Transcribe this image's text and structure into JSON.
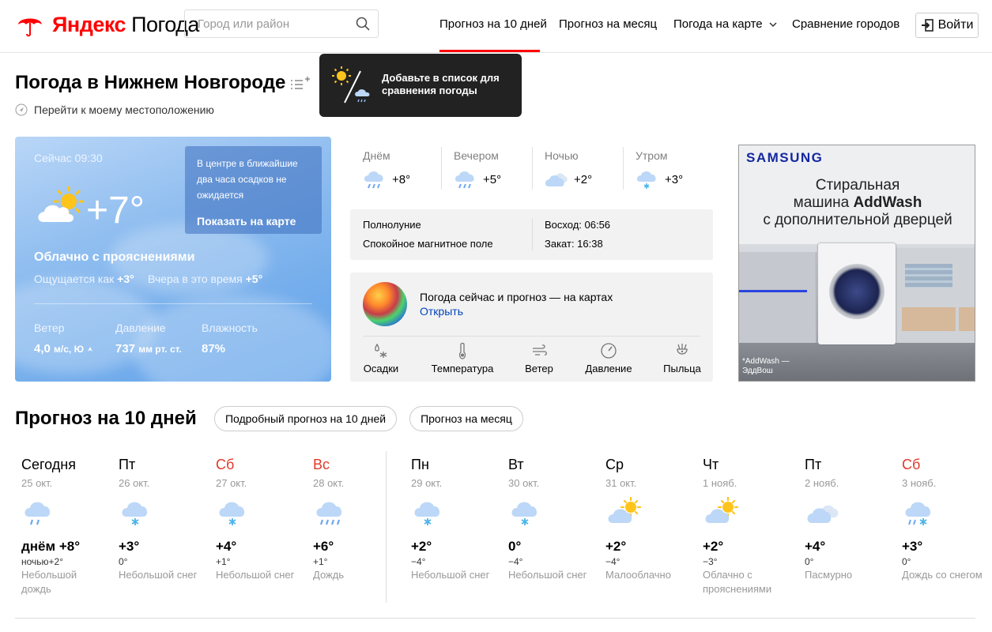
{
  "header": {
    "logo_brand": "Яндекс",
    "logo_product": "Погода",
    "search_placeholder": "Город или район",
    "nav": [
      "Прогноз на 10 дней",
      "Прогноз на месяц",
      "Погода на карте",
      "Сравнение городов"
    ],
    "login": "Войти",
    "accent_color": "#ff0000"
  },
  "title": {
    "text": "Погода в Нижнем Новгороде",
    "location_link": "Перейти к моему местоположению",
    "tooltip": "Добавьте в список для сравнения погоды"
  },
  "now": {
    "time": "Сейчас 09:30",
    "temp": "+7°",
    "icon": "partly-cloudy-icon",
    "popup_text": "В центре в ближайшие два часа осадков не ожидается",
    "popup_link": "Показать на карте",
    "condition": "Облачно с прояснениями",
    "feels_label": "Ощущается как",
    "feels_value": "+3°",
    "yesterday_label": "Вчера в это время",
    "yesterday_value": "+5°",
    "wind_label": "Ветер",
    "wind_value": "4,0",
    "wind_unit": "м/с, Ю",
    "pressure_label": "Давление",
    "pressure_value": "737",
    "pressure_unit": "мм рт. ст.",
    "humidity_label": "Влажность",
    "humidity_value": "87%"
  },
  "parts": [
    {
      "name": "Днём",
      "temp": "+8°",
      "icon": "rain-cloud-icon"
    },
    {
      "name": "Вечером",
      "temp": "+5°",
      "icon": "rain-cloud-icon"
    },
    {
      "name": "Ночью",
      "temp": "+2°",
      "icon": "cloudy-icon"
    },
    {
      "name": "Утром",
      "temp": "+3°",
      "icon": "snow-cloud-icon"
    }
  ],
  "astro": {
    "moon": "Полнолуние",
    "magnetic": "Спокойное магнитное поле",
    "sunrise": "Восход: 06:56",
    "sunset": "Закат: 16:38"
  },
  "maps": {
    "title": "Погода сейчас и прогноз — на картах",
    "open": "Открыть",
    "items": [
      "Осадки",
      "Температура",
      "Ветер",
      "Давление",
      "Пыльца"
    ]
  },
  "ad": {
    "brand": "SAMSUNG",
    "line1": "Стиральная",
    "line2_pre": "машина ",
    "line2_bold": "AddWash",
    "line3": "с дополнительной дверцей",
    "caption1": "*AddWash —",
    "caption2": "ЭддВош"
  },
  "forecast": {
    "title": "Прогноз на 10 дней",
    "btn_detailed": "Подробный прогноз на 10 дней",
    "btn_month": "Прогноз на месяц",
    "days": [
      {
        "name": "Сегодня",
        "date": "25 окт.",
        "hi": "днём +8°",
        "lo": "ночью+2°",
        "cond": "Небольшой дождь",
        "weekend": false,
        "icon": "rain-cloud-icon"
      },
      {
        "name": "Пт",
        "date": "26 окт.",
        "hi": "+3°",
        "lo": "0°",
        "cond": "Небольшой снег",
        "weekend": false,
        "icon": "snow-cloud-icon"
      },
      {
        "name": "Сб",
        "date": "27 окт.",
        "hi": "+4°",
        "lo": "+1°",
        "cond": "Небольшой снег",
        "weekend": true,
        "icon": "snow-cloud-icon"
      },
      {
        "name": "Вс",
        "date": "28 окт.",
        "hi": "+6°",
        "lo": "+1°",
        "cond": "Дождь",
        "weekend": true,
        "icon": "heavy-rain-icon"
      },
      {
        "name": "Пн",
        "date": "29 окт.",
        "hi": "+2°",
        "lo": "−4°",
        "cond": "Небольшой снег",
        "weekend": false,
        "icon": "snow-cloud-icon"
      },
      {
        "name": "Вт",
        "date": "30 окт.",
        "hi": "0°",
        "lo": "−4°",
        "cond": "Небольшой снег",
        "weekend": false,
        "icon": "snow-cloud-icon"
      },
      {
        "name": "Ср",
        "date": "31 окт.",
        "hi": "+2°",
        "lo": "−4°",
        "cond": "Малооблачно",
        "weekend": false,
        "icon": "sun-cloud-icon"
      },
      {
        "name": "Чт",
        "date": "1 нояб.",
        "hi": "+2°",
        "lo": "−3°",
        "cond": "Облачно с прояснениями",
        "weekend": false,
        "icon": "sun-cloud-icon"
      },
      {
        "name": "Пт",
        "date": "2 нояб.",
        "hi": "+4°",
        "lo": "0°",
        "cond": "Пасмурно",
        "weekend": false,
        "icon": "cloudy-icon"
      },
      {
        "name": "Сб",
        "date": "3 нояб.",
        "hi": "+3°",
        "lo": "0°",
        "cond": "Дождь со снегом",
        "weekend": true,
        "icon": "sleet-icon"
      }
    ]
  }
}
